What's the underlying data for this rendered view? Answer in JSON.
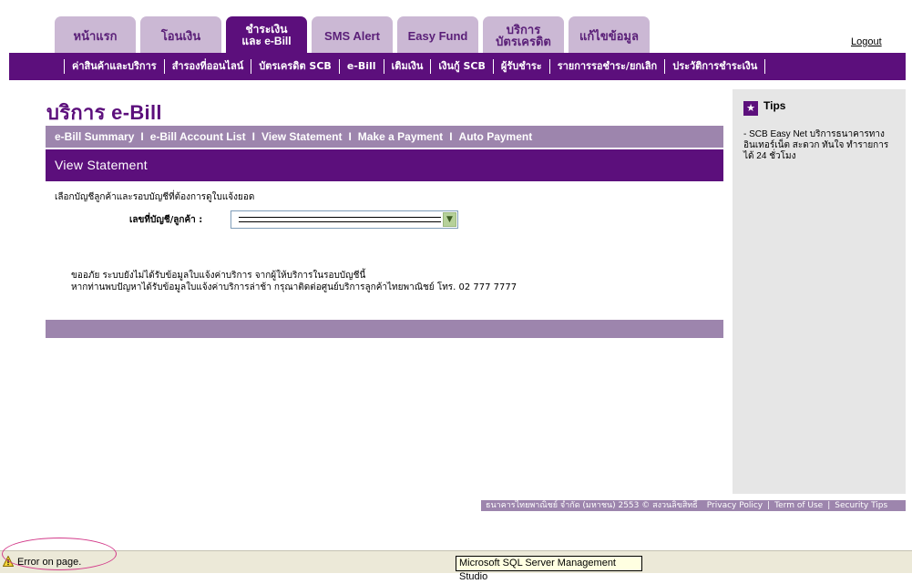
{
  "tabs": [
    {
      "label": "หน้าแรก"
    },
    {
      "label": "โอนเงิน"
    },
    {
      "label_line1": "ชำระเงิน",
      "label_line2": "และ e-Bill"
    },
    {
      "label": "SMS Alert"
    },
    {
      "label": "Easy Fund"
    },
    {
      "label_line1": "บริการ",
      "label_line2": "บัตรเครดิต"
    },
    {
      "label": "แก้ไขข้อมูล"
    }
  ],
  "logout_label": "Logout",
  "menu_items": [
    "ค่าสินค้าและบริการ",
    "สำรองที่ออนไลน์",
    "บัตรเครดิต SCB",
    "e-Bill",
    "เติมเงิน",
    "เงินกู้ SCB",
    "ผู้รับชำระ",
    "รายการรอชำระ/ยกเลิก",
    "ประวัติการชำระเงิน"
  ],
  "page_title": "บริการ e-Bill",
  "subnav": [
    "e-Bill Summary",
    "e-Bill Account List",
    "View Statement",
    "Make a Payment",
    "Auto Payment"
  ],
  "subnav_separator": "I",
  "section_title": "View Statement",
  "instruction": "เลือกบัญชีลูกค้าและรอบบัญชีที่ต้องการดูใบแจ้งยอด",
  "account_label": "เลขที่บัญชี/ลูกค้า :",
  "message_line1": "ขออภัย ระบบยังไม่ได้รับข้อมูลใบแจ้งค่าบริการ จากผู้ให้บริการในรอบบัญชีนี้",
  "message_line2": "หากท่านพบปัญหาได้รับข้อมูลใบแจ้งค่าบริการล่าช้า กรุณาติดต่อศูนย์บริการลูกค้าไทยพาณิชย์ โทร. 02 777 7777",
  "tips": {
    "title": "Tips",
    "text": "- SCB Easy Net บริการธนาคารทางอินเทอร์เน็ต สะดวก ทันใจ ทำรายการได้ 24 ชั่วโมง"
  },
  "footer": {
    "copyright": "ธนาคารไทยพาณิชย์ จำกัด (มหาชน) 2553 © สงวนลิขสิทธิ์",
    "links": [
      "Privacy Policy",
      "Term of Use",
      "Security Tips"
    ]
  },
  "statusbar": {
    "text": "Error on page.",
    "tooltip": "Microsoft SQL Server Management Studio"
  },
  "colors": {
    "brand_purple": "#5c0f7c",
    "light_purple": "#9d85ad",
    "tab_inactive": "#cbb8d4"
  }
}
